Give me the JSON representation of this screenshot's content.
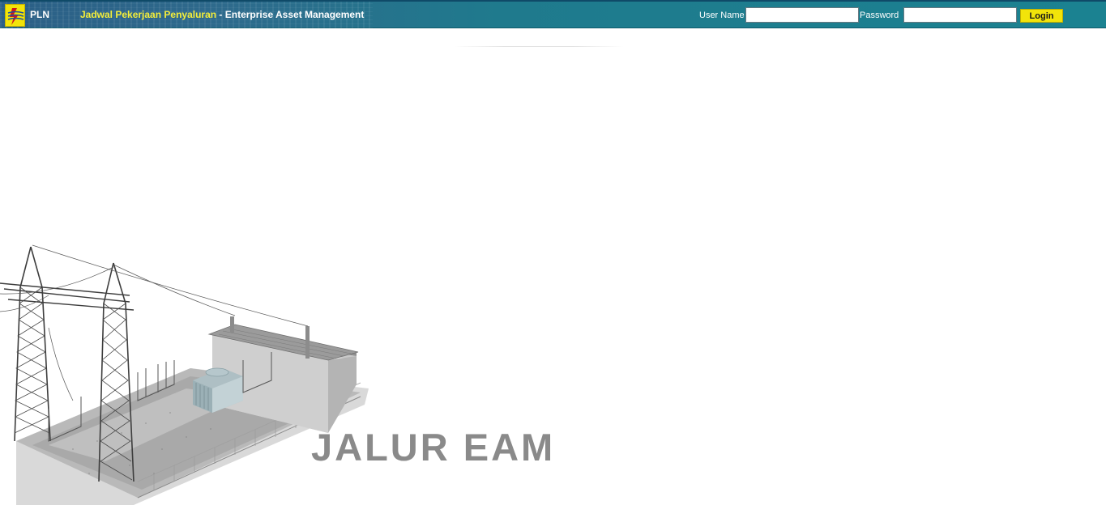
{
  "header": {
    "brand": "PLN",
    "app_title_highlight": "Jadwal Pekerjaan Penyaluran",
    "app_title_rest": " - Enterprise Asset Management"
  },
  "login": {
    "username_label": "User Name",
    "username_value": "",
    "password_label": "Password",
    "password_value": "",
    "submit_label": "Login"
  },
  "hero": {
    "title": "JALUR EAM"
  },
  "colors": {
    "header_bg": "#1f7a8d",
    "accent_yellow": "#f2e40a",
    "title_highlight": "#f5ee3a",
    "hero_title": "#8a8a8a"
  },
  "icons": {
    "logo": "pln-lightning-logo",
    "hero_image": "electrical-substation-illustration"
  }
}
